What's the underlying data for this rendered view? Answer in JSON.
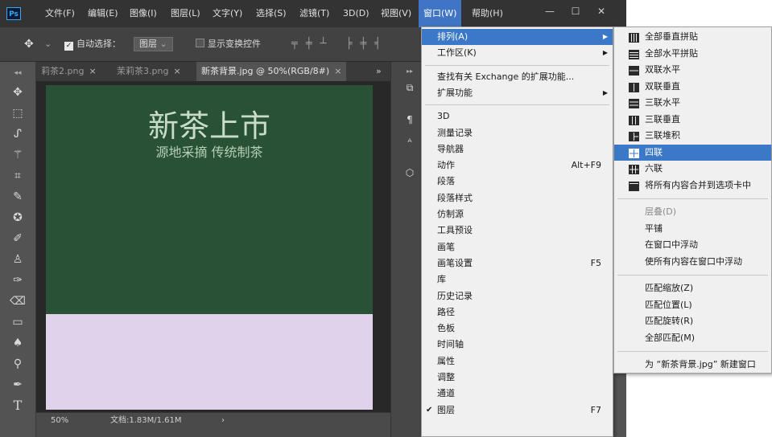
{
  "app": {
    "logo": "Ps",
    "menus": [
      "文件(F)",
      "编辑(E)",
      "图像(I)",
      "图层(L)",
      "文字(Y)",
      "选择(S)",
      "滤镜(T)",
      "3D(D)",
      "视图(V)",
      "窗口(W)",
      "帮助(H)"
    ],
    "active_menu": "窗口(W)",
    "window_controls": [
      "—",
      "☐",
      "✕"
    ]
  },
  "options_bar": {
    "move_icon": "✥",
    "auto_select_label": "自动选择：",
    "auto_select_value": "图层",
    "show_transform_label": "显示变换控件"
  },
  "tabs": [
    {
      "label": "莉茶2.png",
      "active": false
    },
    {
      "label": "茉莉茶3.png",
      "active": false
    },
    {
      "label": "新茶背景.jpg @ 50%(RGB/8#)",
      "active": true
    }
  ],
  "tab_overflow": "»",
  "tab_close": "×",
  "canvas": {
    "headline": "新茶上市",
    "subline": "源地采摘 传统制茶",
    "top_color": "#285135",
    "bottom_color": "#e0d2ea"
  },
  "status": {
    "zoom": "50%",
    "doc_info": "文档:1.83M/1.61M",
    "arrow": "›"
  },
  "window_menu": {
    "items": [
      {
        "label": "排列(A)",
        "submenu": true,
        "highlight": true
      },
      {
        "label": "工作区(K)",
        "submenu": true
      },
      {
        "sep": true
      },
      {
        "label": "查找有关 Exchange 的扩展功能..."
      },
      {
        "label": "扩展功能",
        "submenu": true
      },
      {
        "sep": true
      },
      {
        "label": "3D"
      },
      {
        "label": "测量记录"
      },
      {
        "label": "导航器"
      },
      {
        "label": "动作",
        "shortcut": "Alt+F9"
      },
      {
        "label": "段落"
      },
      {
        "label": "段落样式"
      },
      {
        "label": "仿制源"
      },
      {
        "label": "工具预设"
      },
      {
        "label": "画笔"
      },
      {
        "label": "画笔设置",
        "shortcut": "F5"
      },
      {
        "label": "库"
      },
      {
        "label": "历史记录"
      },
      {
        "label": "路径"
      },
      {
        "label": "色板"
      },
      {
        "label": "时间轴"
      },
      {
        "label": "属性"
      },
      {
        "label": "调整"
      },
      {
        "label": "通道"
      },
      {
        "label": "图层",
        "shortcut": "F7",
        "checked": true
      }
    ],
    "submenu_arrow": "▶",
    "check_mark": "✔"
  },
  "arrange_menu": {
    "items": [
      {
        "label": "全部垂直拼贴",
        "icon": "cols4"
      },
      {
        "label": "全部水平拼贴",
        "icon": "rows4"
      },
      {
        "label": "双联水平",
        "icon": "rows2"
      },
      {
        "label": "双联垂直",
        "icon": "cols2"
      },
      {
        "label": "三联水平",
        "icon": "rows3"
      },
      {
        "label": "三联垂直",
        "icon": "cols3"
      },
      {
        "label": "三联堆积",
        "icon": "stack3"
      },
      {
        "label": "四联",
        "icon": "grid4",
        "highlight": true
      },
      {
        "label": "六联",
        "icon": "grid6"
      },
      {
        "label": "将所有内容合并到选项卡中",
        "icon": "single"
      },
      {
        "sep": true
      },
      {
        "label": "层叠(D)",
        "disabled": true
      },
      {
        "label": "平铺"
      },
      {
        "label": "在窗口中浮动"
      },
      {
        "label": "使所有内容在窗口中浮动"
      },
      {
        "sep": true
      },
      {
        "label": "匹配缩放(Z)"
      },
      {
        "label": "匹配位置(L)"
      },
      {
        "label": "匹配旋转(R)"
      },
      {
        "label": "全部匹配(M)"
      },
      {
        "sep": true
      },
      {
        "label": "为 “新茶背景.jpg” 新建窗口"
      }
    ]
  }
}
